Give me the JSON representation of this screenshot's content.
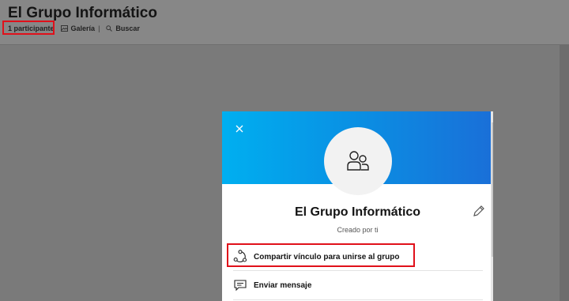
{
  "header": {
    "title": "El Grupo Informático",
    "participants_label": "1 participante",
    "gallery_label": "Galería",
    "gallery_separator": "|",
    "search_label": "Buscar"
  },
  "panel": {
    "group_name": "El Grupo Informático",
    "created_by": "Creado por ti",
    "actions": [
      {
        "label": "Compartir vínculo para unirse al grupo",
        "icon": "share-link-icon"
      },
      {
        "label": "Enviar mensaje",
        "icon": "message-icon"
      }
    ],
    "close_icon": "close-icon",
    "edit_icon": "pencil-icon",
    "avatar_icon": "group-people-icon"
  },
  "colors": {
    "banner_start": "#00aff0",
    "banner_end": "#1a6fd8",
    "highlight": "#e0101a",
    "overlay": "#7a7a7a"
  }
}
